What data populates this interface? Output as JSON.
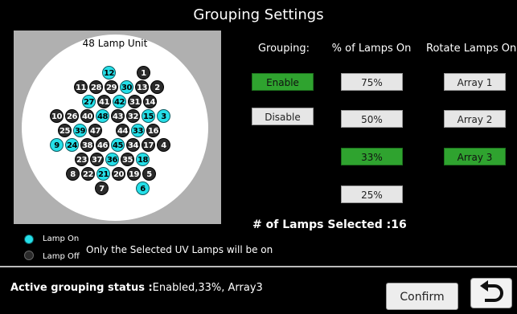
{
  "title": "Grouping Settings",
  "lamp_unit": {
    "title": "48 Lamp Unit",
    "lamps": [
      {
        "n": "12",
        "on": true
      },
      {
        "n": "1",
        "on": false
      },
      {
        "n": "11",
        "on": false
      },
      {
        "n": "28",
        "on": false
      },
      {
        "n": "29",
        "on": false
      },
      {
        "n": "30",
        "on": true
      },
      {
        "n": "13",
        "on": false
      },
      {
        "n": "2",
        "on": false
      },
      {
        "n": "27",
        "on": true
      },
      {
        "n": "41",
        "on": false
      },
      {
        "n": "42",
        "on": true
      },
      {
        "n": "31",
        "on": false
      },
      {
        "n": "14",
        "on": false
      },
      {
        "n": "10",
        "on": false
      },
      {
        "n": "26",
        "on": false
      },
      {
        "n": "40",
        "on": false
      },
      {
        "n": "48",
        "on": true
      },
      {
        "n": "43",
        "on": false
      },
      {
        "n": "32",
        "on": false
      },
      {
        "n": "15",
        "on": true
      },
      {
        "n": "3",
        "on": true
      },
      {
        "n": "25",
        "on": false
      },
      {
        "n": "39",
        "on": true
      },
      {
        "n": "47",
        "on": false
      },
      {
        "n": "44",
        "on": false
      },
      {
        "n": "33",
        "on": true
      },
      {
        "n": "16",
        "on": false
      },
      {
        "n": "9",
        "on": true
      },
      {
        "n": "24",
        "on": true
      },
      {
        "n": "38",
        "on": false
      },
      {
        "n": "46",
        "on": false
      },
      {
        "n": "45",
        "on": true
      },
      {
        "n": "34",
        "on": false
      },
      {
        "n": "17",
        "on": false
      },
      {
        "n": "4",
        "on": false
      },
      {
        "n": "23",
        "on": false
      },
      {
        "n": "37",
        "on": false
      },
      {
        "n": "36",
        "on": true
      },
      {
        "n": "35",
        "on": false
      },
      {
        "n": "18",
        "on": true
      },
      {
        "n": "8",
        "on": false
      },
      {
        "n": "22",
        "on": false
      },
      {
        "n": "21",
        "on": true
      },
      {
        "n": "20",
        "on": false
      },
      {
        "n": "19",
        "on": false
      },
      {
        "n": "5",
        "on": false
      },
      {
        "n": "7",
        "on": false
      },
      {
        "n": "6",
        "on": true
      }
    ]
  },
  "legend": {
    "on_label": "Lamp On",
    "off_label": "Lamp Off",
    "note": "Only the Selected UV Lamps will be on"
  },
  "grouping": {
    "header": "Grouping:",
    "options": [
      {
        "label": "Enable",
        "selected": true
      },
      {
        "label": "Disable",
        "selected": false
      }
    ]
  },
  "percent": {
    "header": "% of Lamps On",
    "options": [
      {
        "label": "75%",
        "selected": false
      },
      {
        "label": "50%",
        "selected": false
      },
      {
        "label": "33%",
        "selected": true
      },
      {
        "label": "25%",
        "selected": false
      }
    ]
  },
  "rotate": {
    "header": "Rotate Lamps On",
    "options": [
      {
        "label": "Array 1",
        "selected": false
      },
      {
        "label": "Array 2",
        "selected": false
      },
      {
        "label": "Array 3",
        "selected": true
      }
    ]
  },
  "selected": {
    "label": "# of Lamps Selected :",
    "count": "16"
  },
  "status": {
    "label": "Active grouping status :",
    "value": "Enabled,33%, Array3"
  },
  "confirm_label": "Confirm",
  "back_icon": "return-arrow-icon"
}
